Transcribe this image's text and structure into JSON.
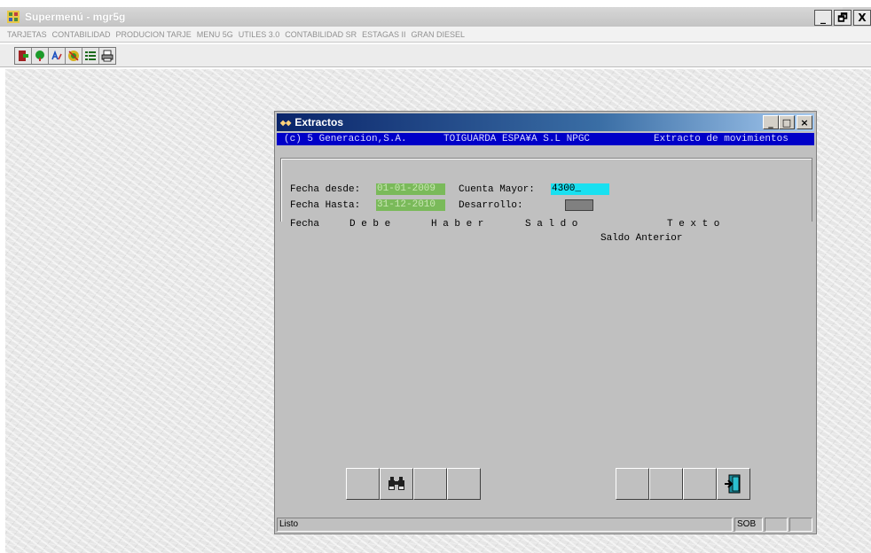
{
  "app": {
    "title": "Supermenú - mgr5g",
    "window_controls": {
      "minimize": "_",
      "restore": "🗗",
      "close": "X"
    }
  },
  "menu": {
    "items": [
      "TARJETAS",
      "CONTABILIDAD",
      "PRODUCION TARJE",
      "MENU 5G",
      "UTILES 3.0",
      "CONTABILIDAD SR",
      "ESTAGAS II",
      "GRAN DIESEL"
    ]
  },
  "toolbar": {
    "icons": [
      "exit-door-icon",
      "green-tree-icon",
      "letters-icon",
      "target-icon",
      "list-icon",
      "printer-icon"
    ]
  },
  "child": {
    "title": "Extractos",
    "info": {
      "company": "(c) 5 Generacion,S.A.",
      "client": "TOIGUARDA ESPA¥A S.L NPGC",
      "module": "Extracto de movimientos"
    },
    "form": {
      "fecha_desde_label": "Fecha desde:",
      "fecha_desde_value": "01-01-2009",
      "fecha_hasta_label": "Fecha Hasta:",
      "fecha_hasta_value": "31-12-2010",
      "cuenta_mayor_label": "Cuenta Mayor:",
      "cuenta_mayor_value": "4300_",
      "desarrollo_label": "Desarrollo:",
      "desarrollo_value": ""
    },
    "columns": {
      "fecha": "Fecha",
      "debe": "D e b e",
      "haber": "H a b e r",
      "saldo": "S a l d o",
      "texto": "T e x t o"
    },
    "rows": {
      "saldo_anterior": "Saldo Anterior"
    },
    "status": {
      "text": "Listo",
      "sob": "SOB"
    }
  },
  "colors": {
    "info_bar": "#0000c8",
    "field_green": "#7aba5a",
    "field_cyan": "#19e0f0",
    "window_gray": "#c0c0c0"
  }
}
